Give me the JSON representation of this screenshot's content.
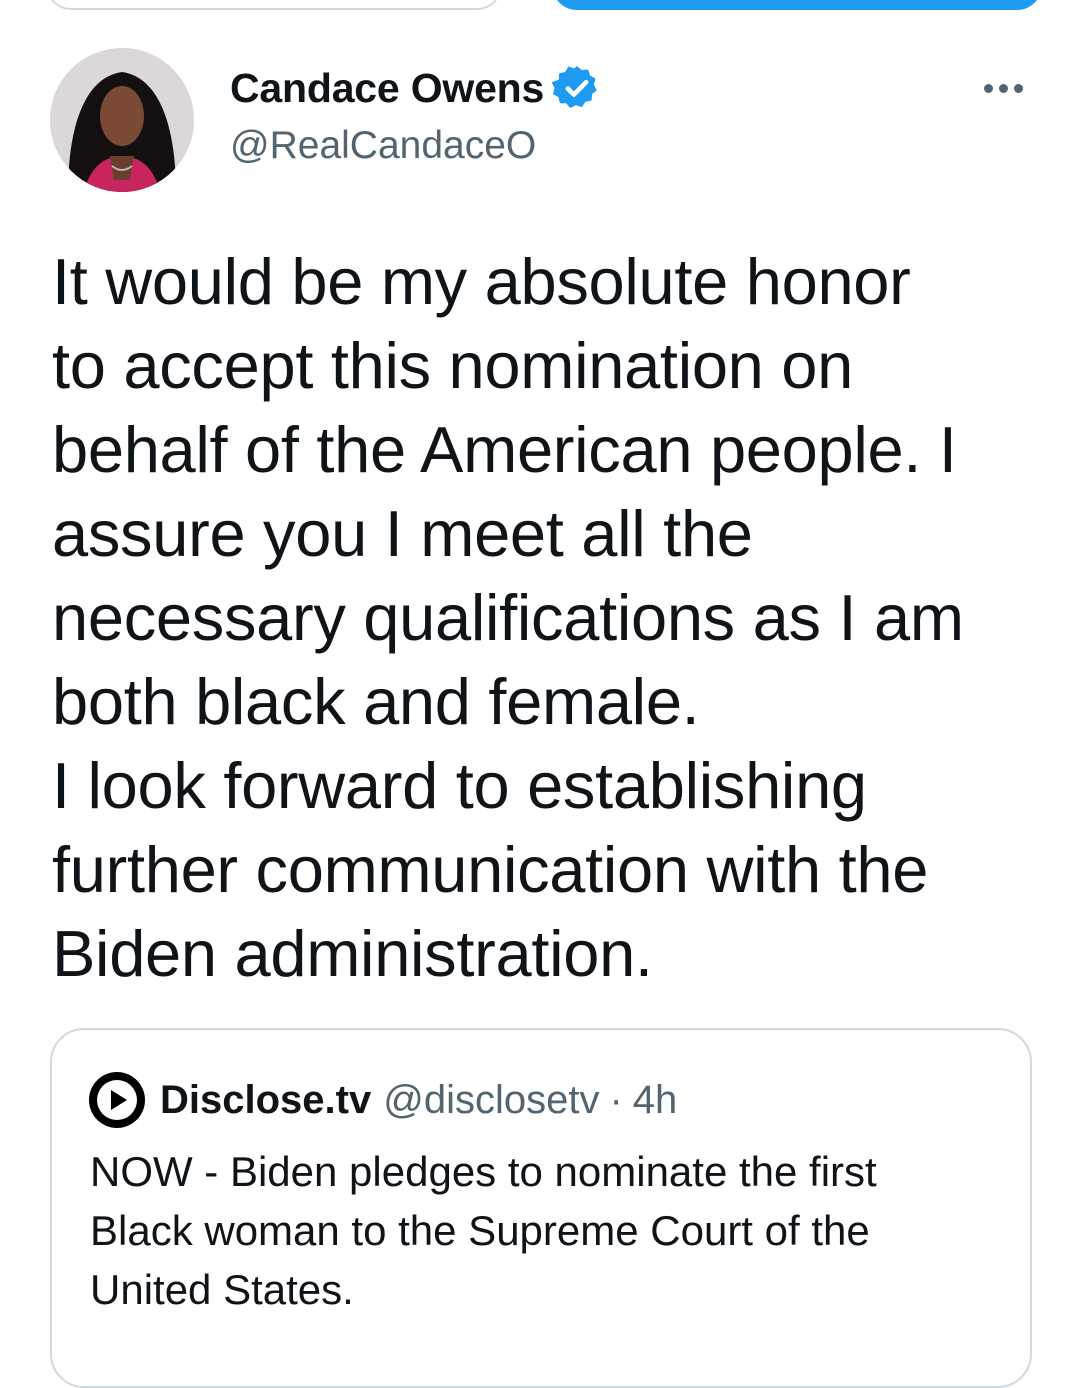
{
  "tweet": {
    "author": {
      "display_name": "Candace Owens",
      "handle": "@RealCandaceO",
      "verified": true
    },
    "body_lines": [
      "It would be my absolute honor",
      "to accept this nomination on",
      "behalf of the American people. I",
      "assure you I meet all the",
      "necessary qualifications as I am",
      "both black and female.",
      "I look forward to establishing",
      "further communication with the",
      "Biden administration."
    ]
  },
  "quoted_tweet": {
    "display_name": "Disclose.tv",
    "handle": "@disclosetv",
    "separator": "·",
    "time": "4h",
    "body_lines": [
      "NOW - Biden pledges to nominate the first",
      "Black woman to the Supreme Court of the",
      "United States."
    ]
  },
  "colors": {
    "accent": "#1d9bf0",
    "text": "#0f1419",
    "secondary": "#536471",
    "border": "#cfd9de"
  }
}
